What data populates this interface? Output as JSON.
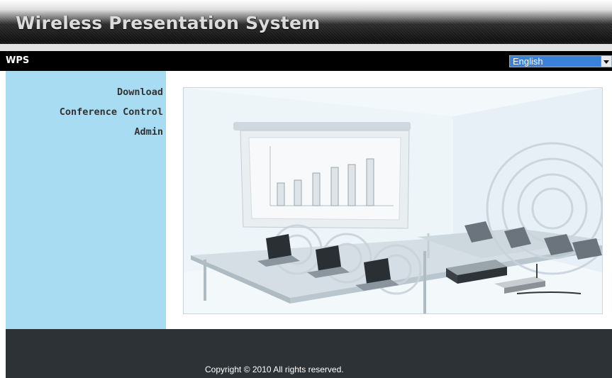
{
  "header": {
    "title": "Wireless Presentation System"
  },
  "navbar": {
    "brand": "WPS"
  },
  "language": {
    "selected": "English"
  },
  "sidebar": {
    "items": [
      {
        "label": "Download"
      },
      {
        "label": "Conference Control"
      },
      {
        "label": "Admin"
      }
    ]
  },
  "main": {
    "illustration_icon": "conference-room-illustration"
  },
  "footer": {
    "copyright": "Copyright © 2010 All rights reserved."
  },
  "colors": {
    "sidebar_bg": "#a8dcf2",
    "navbar_bg": "#000000",
    "footer_bg": "#2d3236",
    "select_bg": "#3a82d8"
  }
}
